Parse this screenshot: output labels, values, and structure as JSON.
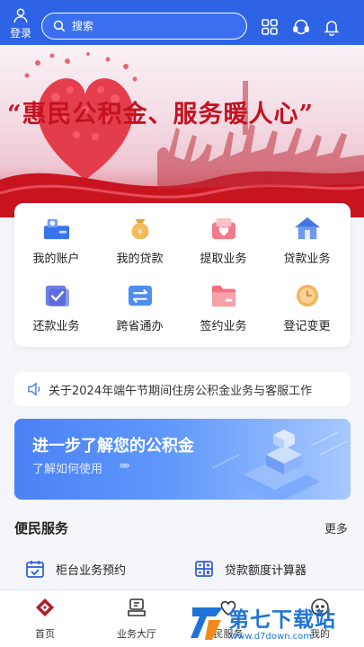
{
  "header": {
    "login_label": "登录",
    "search_placeholder": "搜索",
    "icons": [
      "apps-grid-icon",
      "customer-service-icon",
      "bell-icon"
    ],
    "background": "#2e63e6"
  },
  "banner": {
    "slogan": "“惠民公积金、服务暖人心”"
  },
  "grid": [
    {
      "label": "我的账户",
      "icon": "account-icon"
    },
    {
      "label": "我的贷款",
      "icon": "loan-bag-icon"
    },
    {
      "label": "提取业务",
      "icon": "withdraw-icon"
    },
    {
      "label": "贷款业务",
      "icon": "house-icon"
    },
    {
      "label": "还款业务",
      "icon": "repay-icon"
    },
    {
      "label": "跨省通办",
      "icon": "cross-province-icon"
    },
    {
      "label": "签约业务",
      "icon": "contract-folder-icon"
    },
    {
      "label": "登记变更",
      "icon": "clock-icon"
    }
  ],
  "notice": {
    "text": "关于2024年端午节期间住房公积金业务与客服工作"
  },
  "promo": {
    "title": "进一步了解您的公积金",
    "subtitle": "了解如何使用",
    "chevrons": "»»"
  },
  "service": {
    "title": "便民服务",
    "more": "更多",
    "items": [
      {
        "label": "柜台业务预约",
        "icon": "calendar-icon"
      },
      {
        "label": "贷款额度计算器",
        "icon": "calculator-icon"
      }
    ]
  },
  "nav": [
    {
      "label": "首页",
      "icon": "home-logo-icon"
    },
    {
      "label": "业务大厅",
      "icon": "hall-icon"
    },
    {
      "label": "民服务",
      "icon": "service-heart-icon"
    },
    {
      "label": "我的",
      "icon": "profile-icon"
    }
  ],
  "watermark": {
    "title": "第七下载站",
    "url": "www.d7down.com"
  }
}
